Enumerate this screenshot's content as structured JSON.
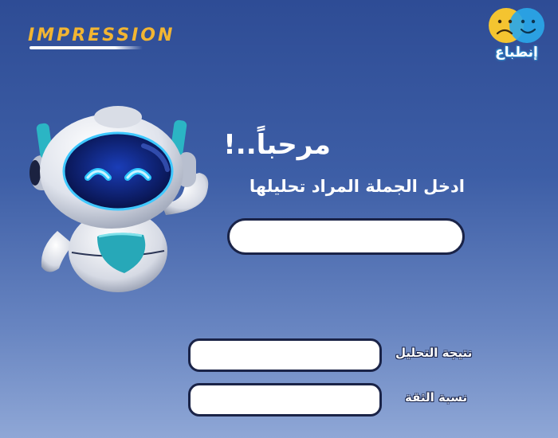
{
  "brand": {
    "logo_text": "IMPRESSION",
    "logo_color": "#f2b532"
  },
  "app_logo": {
    "name": "إنطباع",
    "icon": "sad-happy-faces-icon"
  },
  "robot": {
    "icon": "robot-mascot-icon"
  },
  "welcome": {
    "title": "مرحباً..!",
    "prompt": "ادخل الجملة المراد تحليلها"
  },
  "sentence_input": {
    "value": "",
    "placeholder": ""
  },
  "results": {
    "analysis_label": "نتيجة التحليل",
    "analysis_value": "",
    "confidence_label": "نسبة الثقة",
    "confidence_value": ""
  },
  "colors": {
    "background_top": "#2e4c95",
    "background_bottom": "#8fa7d6",
    "input_border": "#1a2347",
    "robot_eye": "#2ec6ff"
  }
}
